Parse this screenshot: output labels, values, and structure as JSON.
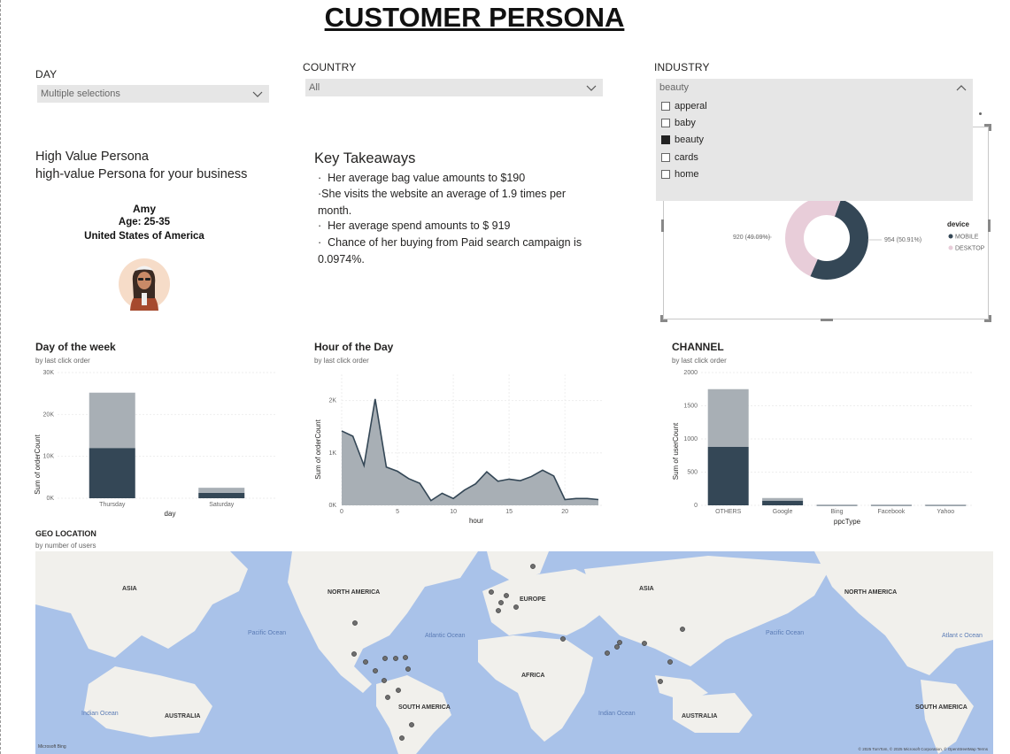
{
  "header": {
    "title": "CUSTOMER PERSONA"
  },
  "slicers": {
    "day": {
      "label": "DAY",
      "value": "Multiple selections"
    },
    "country": {
      "label": "COUNTRY",
      "value": "All"
    },
    "industry": {
      "label": "INDUSTRY",
      "value": "beauty",
      "options": [
        {
          "label": "apperal",
          "checked": false
        },
        {
          "label": "baby",
          "checked": false
        },
        {
          "label": "beauty",
          "checked": true
        },
        {
          "label": "cards",
          "checked": false
        },
        {
          "label": "home",
          "checked": false
        }
      ]
    }
  },
  "persona": {
    "heading": "High Value Persona",
    "subheading": "high-value Persona for your business",
    "name": "Amy",
    "age": "Age: 25-35",
    "country": "United States of America"
  },
  "takeaways": {
    "title": "Key Takeaways",
    "items": [
      "Her average bag value amounts to $190",
      "She visits the website an average of 1.9 times per month.",
      "Her average spend amounts to $ 919",
      "Chance of her buying from Paid search campaign is 0.0974%."
    ]
  },
  "device_chart": {
    "legend_title": "device",
    "labels": {
      "desktop": "920 (49.09%)",
      "mobile": "954 (50.91%)"
    },
    "chart_data": {
      "type": "pie",
      "series": [
        {
          "name": "MOBILE",
          "value": 954,
          "color": "#344756"
        },
        {
          "name": "DESKTOP",
          "value": 920,
          "color": "#e8cdd9"
        }
      ]
    }
  },
  "day_chart": {
    "title": "Day of the week",
    "subtitle": "by last click order",
    "ylabel": "Sum of orderCount",
    "xlabel": "day",
    "yticks": [
      "0K",
      "10K",
      "20K",
      "30K"
    ],
    "chart_data": {
      "type": "bar",
      "categories": [
        "Thursday",
        "Saturday"
      ],
      "series": [
        {
          "name": "dark",
          "values": [
            12000,
            1300
          ],
          "color": "#344756"
        },
        {
          "name": "light",
          "values": [
            13200,
            1200
          ],
          "color": "#a8afb5"
        }
      ],
      "ylim": [
        0,
        30000
      ]
    }
  },
  "hour_chart": {
    "title": "Hour of the Day",
    "subtitle": "by last click order",
    "ylabel": "Sum of orderCount",
    "xlabel": "hour",
    "yticks": [
      "0K",
      "1K",
      "2K"
    ],
    "xticks": [
      "0",
      "5",
      "10",
      "15",
      "20"
    ],
    "chart_data": {
      "type": "area",
      "x": [
        0,
        1,
        2,
        3,
        4,
        5,
        6,
        7,
        8,
        9,
        10,
        11,
        12,
        13,
        14,
        15,
        16,
        17,
        18,
        19,
        20,
        21,
        22,
        23
      ],
      "values": [
        1420,
        1320,
        760,
        2030,
        730,
        650,
        510,
        420,
        90,
        230,
        130,
        290,
        410,
        640,
        460,
        500,
        470,
        550,
        670,
        560,
        110,
        130,
        130,
        110
      ],
      "ylim": [
        0,
        2500
      ],
      "color": "#a8afb5"
    }
  },
  "channel_chart": {
    "title": "CHANNEL",
    "subtitle": "by last click order",
    "ylabel": "Sum of userCount",
    "xlabel": "ppcType",
    "yticks": [
      "0",
      "500",
      "1000",
      "1500",
      "2000"
    ],
    "chart_data": {
      "type": "bar",
      "categories": [
        "OTHERS",
        "Google",
        "Bing",
        "Facebook",
        "Yahoo"
      ],
      "series": [
        {
          "name": "dark",
          "values": [
            880,
            70,
            6,
            6,
            6
          ],
          "color": "#344756"
        },
        {
          "name": "light",
          "values": [
            870,
            40,
            6,
            6,
            6
          ],
          "color": "#a8afb5"
        }
      ],
      "ylim": [
        0,
        2000
      ]
    }
  },
  "geo": {
    "title": "GEO LOCATION",
    "subtitle": "by number of users",
    "labels": {
      "asia_left": "ASIA",
      "na_left": "NORTH AMERICA",
      "europe": "EUROPE",
      "asia_right": "ASIA",
      "na_right": "NORTH AMERICA",
      "pacific_left": "Pacific Ocean",
      "atlantic": "Atlantic Ocean",
      "pacific_right": "Pacific Ocean",
      "atlantic_right": "Atlant c Ocean",
      "africa": "AFRICA",
      "indian_left": "Indian Ocean",
      "indian_right": "Indian Ocean",
      "australia_left": "AUSTRALIA",
      "south_america": "SOUTH AMERICA",
      "australia_right": "AUSTRALIA",
      "south_america_right": "SOUTH AMERICA"
    },
    "logo": "Microsoft Bing",
    "copyright": "© 2025 TomTom, © 2025 Microsoft Corporation, © OpenStreetMap  Terms"
  }
}
